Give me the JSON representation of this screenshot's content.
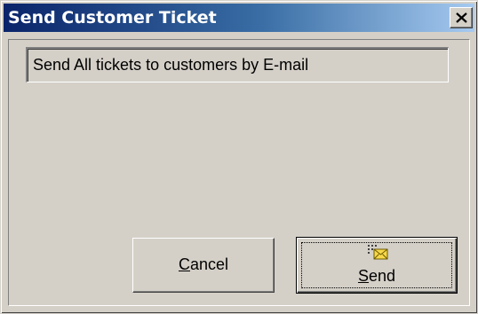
{
  "window": {
    "title": "Send Customer Ticket",
    "close_icon": "close-icon"
  },
  "message": {
    "text": "Send All tickets to customers by E-mail"
  },
  "buttons": {
    "cancel": {
      "label_mnemonic": "C",
      "label_rest": "ancel"
    },
    "send": {
      "label_mnemonic": "S",
      "label_rest": "end",
      "icon": "envelope-icon"
    }
  },
  "colors": {
    "title_gradient_start": "#0a246a",
    "title_gradient_end": "#a6caf0",
    "face": "#d4d0c8",
    "envelope": "#f7d84a"
  }
}
